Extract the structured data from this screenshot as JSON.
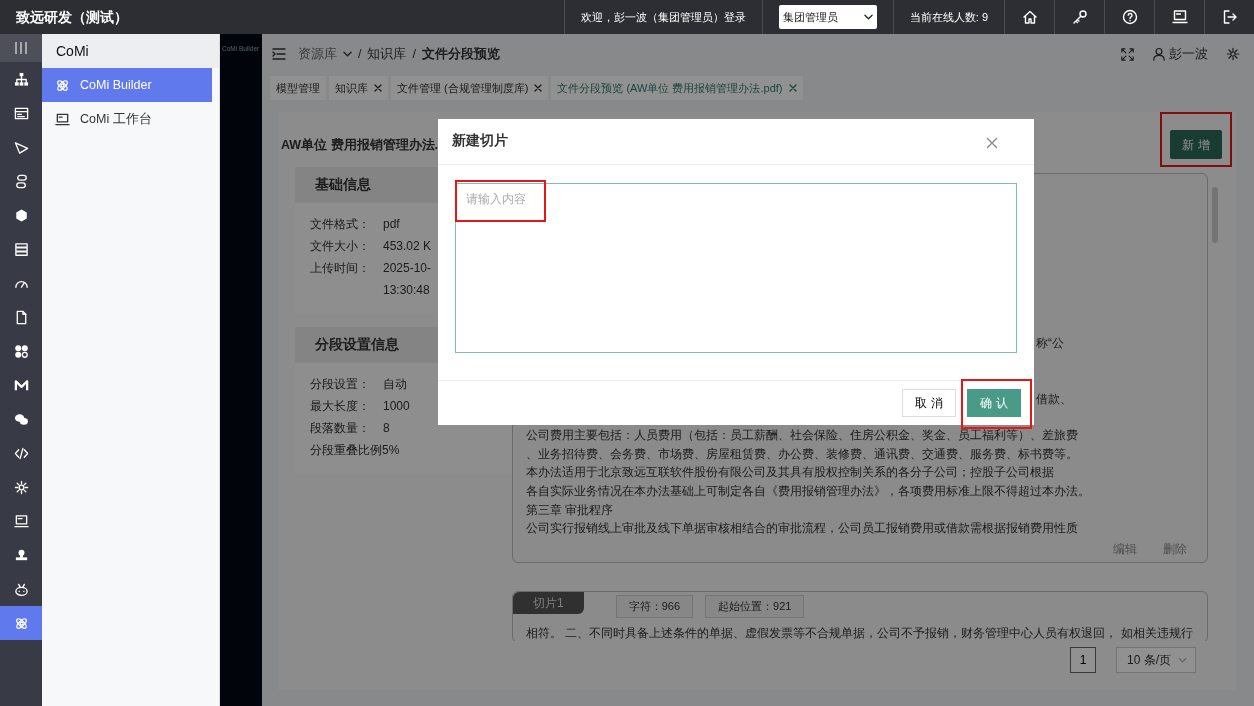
{
  "topbar": {
    "title": "致远研发（测试）",
    "welcome": "欢迎，彭一波（集团管理员）登录",
    "role_select": {
      "value": "集团管理员"
    },
    "online": "当前在线人数: 9"
  },
  "rail": [
    {
      "selected": false
    },
    {
      "selected": false
    },
    {
      "selected": false
    },
    {
      "selected": false
    },
    {
      "selected": false
    },
    {
      "selected": false
    },
    {
      "selected": false
    },
    {
      "selected": false
    },
    {
      "selected": false
    },
    {
      "selected": false
    },
    {
      "selected": false
    },
    {
      "selected": false
    },
    {
      "selected": false
    },
    {
      "selected": false
    },
    {
      "selected": false
    },
    {
      "selected": false
    },
    {
      "selected": true
    }
  ],
  "sidebar": {
    "title": "CoMi",
    "items": [
      {
        "label": "CoMi Builder",
        "selected": true
      },
      {
        "label": "CoMi 工作台",
        "selected": false
      }
    ]
  },
  "logo_text": "CoMi Builder",
  "breadcrumb": [
    {
      "label": "资源库"
    },
    {
      "separator": "/",
      "label": "知识库"
    },
    {
      "separator": "/",
      "label": "文件分段预览"
    }
  ],
  "user": "彭一波",
  "tabs": [
    {
      "label": "模型管理",
      "closable": false,
      "selected": false
    },
    {
      "label": "知识库",
      "closable": true,
      "selected": false
    },
    {
      "label": "文件管理 (合规管理制度库)",
      "closable": true,
      "selected": false
    },
    {
      "label": "文件分段预览 (AW单位 费用报销管理办法.pdf)",
      "closable": true,
      "selected": true
    }
  ],
  "document": {
    "title": "AW单位 费用报销管理办法.",
    "panels": [
      {
        "title": "基础信息",
        "rows": [
          {
            "label": "文件格式：",
            "value": "pdf"
          },
          {
            "label": "文件大小：",
            "value": "453.02 K"
          },
          {
            "label": "上传时间：",
            "value": "2025-10-",
            "value_more": "13:30:48"
          }
        ]
      },
      {
        "title": "分段设置信息",
        "rows": [
          {
            "label": "分段设置：",
            "value": "自动"
          },
          {
            "label": "最大长度：",
            "value": "1000"
          },
          {
            "label": "段落数量：",
            "value": "8"
          },
          {
            "label": "分段重叠比例",
            "value": "5%"
          }
        ]
      }
    ]
  },
  "new_button": {
    "label": "新 增",
    "highlighted": true
  },
  "chunks": [
    {
      "lines": [
        {
          "kind": "tail",
          "text": "称“公"
        },
        {
          "kind": "tail",
          "text": "借款、"
        },
        {
          "kind": "full",
          "text": "公司费用主要包括：人员费用（包括：员工薪酬、社会保险、住房公积金、奖金、员工福利等）、差旅费"
        },
        {
          "kind": "full",
          "text": "、业务招待费、会务费、市场费、房屋租赁费、办公费、装修费、通讯费、交通费、服务费、标书费等。"
        },
        {
          "kind": "full",
          "text": "本办法适用于北京致远互联软件股份有限公司及其具有股权控制关系的各分子公司；控股子公司根据"
        },
        {
          "kind": "full",
          "text": "各自实际业务情况在本办法基础上可制定各自《费用报销管理办法》，各项费用标准上限不得超过本办法。"
        },
        {
          "kind": "full",
          "text": "第三章  审批程序"
        },
        {
          "kind": "full",
          "text": "公司实行报销线上审批及线下单据审核相结合的审批流程，公司员工报销费用或借款需根据报销费用性质"
        }
      ],
      "actions": [
        "编辑",
        "删除"
      ]
    },
    {
      "tag": "切片1",
      "chars": "字符：966",
      "start": "起始位置：921",
      "lines": [
        {
          "kind": "full",
          "text": "相符。  二、不同时具备上述条件的单据、虚假发票等不合规单据，公司不予报销，财务管理中心人员有权退回，  如相关违规行"
        }
      ]
    }
  ],
  "pagination": {
    "pages": [
      {
        "label": "1",
        "selected": true
      }
    ],
    "page_size": "10 条/页"
  },
  "modal": {
    "title": "新建切片",
    "textarea": {
      "placeholder": "请输入内容",
      "highlighted": true
    },
    "cancel": "取 消",
    "confirm": {
      "label": "确 认",
      "highlighted": true
    }
  }
}
